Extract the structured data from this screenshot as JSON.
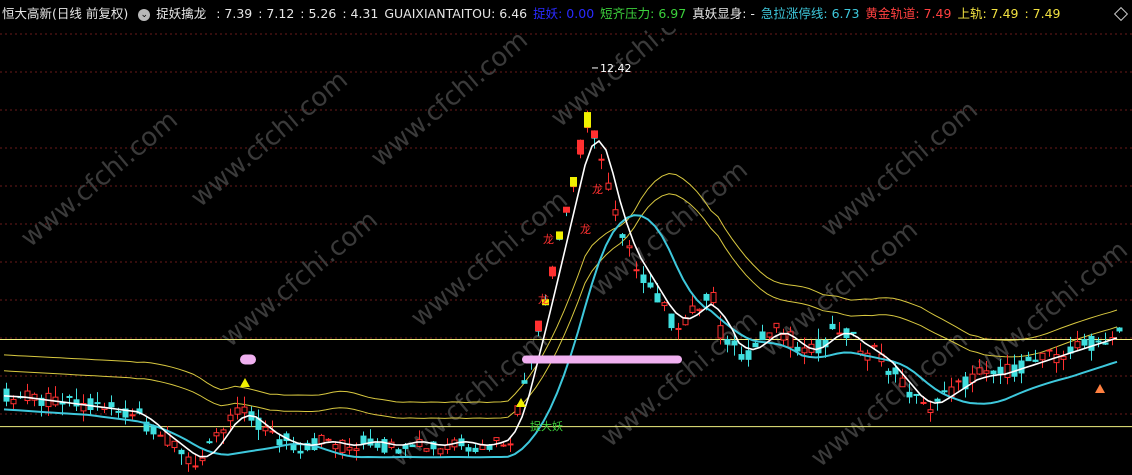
{
  "window": {
    "title": "恒大高新(日线 前复权)",
    "indicator_name": "捉妖擒龙",
    "indicator_values": [
      {
        "label": "",
        "value": "7.39",
        "color": "#e6e6e6"
      },
      {
        "label": "",
        "value": "7.12",
        "color": "#e6e6e6"
      },
      {
        "label": "",
        "value": "5.26",
        "color": "#e6e6e6"
      },
      {
        "label": "",
        "value": "4.31",
        "color": "#e6e6e6"
      },
      {
        "label": "GUAIXIANTAITOU:",
        "value": "6.46",
        "color": "#e6e6e6"
      },
      {
        "label": "捉妖:",
        "value": "0.00",
        "color": "#2a2aff"
      },
      {
        "label": "短齐压力:",
        "value": "6.97",
        "color": "#3cd23c"
      },
      {
        "label": "真妖显身:",
        "value": "-",
        "color": "#e6e6e6"
      },
      {
        "label": "急拉涨停线:",
        "value": "6.73",
        "color": "#3ec8dc"
      },
      {
        "label": "黄金轨道:",
        "value": "7.49",
        "color": "#ff4040"
      },
      {
        "label": "上轨:",
        "value": "7.49",
        "color": "#f0e040"
      },
      {
        "label": "",
        "value": "7.49",
        "color": "#f0e040"
      }
    ]
  },
  "colors": {
    "up": "#ff3030",
    "down": "#40e0e0",
    "white_line": "#ffffff",
    "cyan_line": "#3ec8dc",
    "yellow_band": "#d8c840",
    "horizontal_line": "#f0f080",
    "grid": "#6a1a1a",
    "pink_bar": "#f0b0f0",
    "signal_yellow": "#f0f000",
    "watermark": "#3a3a3a"
  },
  "watermark_text": "www.cfchi.com",
  "chart_data": {
    "type": "candlestick",
    "price_range": [
      3.5,
      13.3
    ],
    "max_label": "12.42",
    "annotations": {
      "dragon": "龙",
      "catch": "捉大妖"
    },
    "pink_bar_value": 6.0,
    "horizontal_lines": [
      6.44,
      4.52
    ]
  }
}
